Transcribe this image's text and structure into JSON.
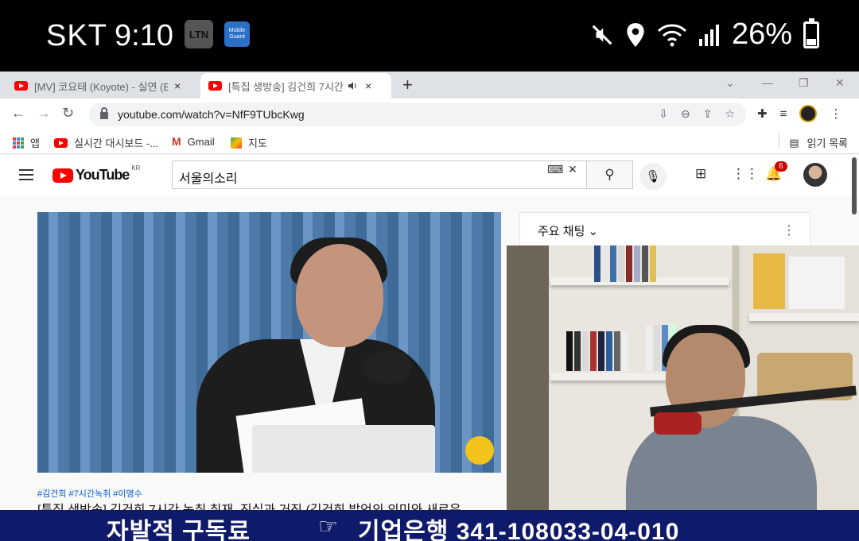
{
  "status_bar": {
    "carrier": "SKT",
    "time": "9:10",
    "app_badge_ltn": "LTN",
    "app_badge_guard": "Mobile Guard",
    "battery_percent": "26%",
    "battery_level": 0.26
  },
  "browser": {
    "tabs": [
      {
        "title": "[MV] 코요태 (Koyote) - 실연 (Br",
        "close": "×"
      },
      {
        "title": "[특집 생방송] 김건희 7시간",
        "close": "×"
      }
    ],
    "new_tab": "+",
    "url": "youtube.com/watch?v=NfF9TUbcKwg",
    "bookmarks": [
      {
        "label": "앱"
      },
      {
        "label": "실시간 대시보드 -..."
      },
      {
        "label": "Gmail"
      },
      {
        "label": "지도"
      }
    ],
    "reading_list": "읽기 목록"
  },
  "youtube": {
    "logo": "YouTube",
    "region": "KR",
    "search_value": "서울의소리",
    "notification_count": "6",
    "video_tags": "#김건희 #7시간녹취 #이명수",
    "video_title": "[특집 생방송] 김건희 7시간 녹취 취재, 진실과 거짓 (김건희 발언의 의미와 새로운",
    "chat_panel_title": "주요 채팅",
    "chat_more": "⋮"
  },
  "overlay_banner": {
    "text_left": "자발적 구독료",
    "hand_icon": "☞",
    "text_right": "기업은행 341-108033-04-010"
  }
}
